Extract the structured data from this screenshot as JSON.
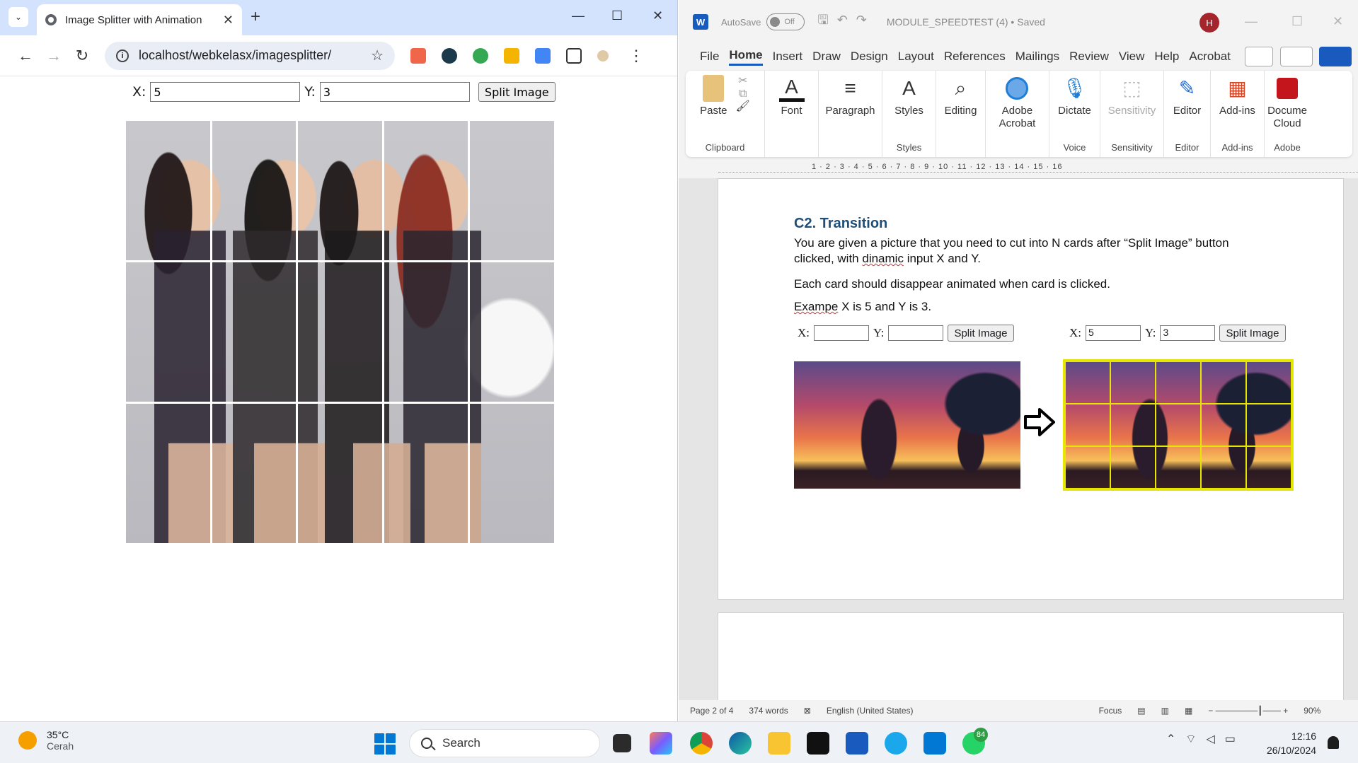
{
  "chrome": {
    "tab_title": "Image Splitter with Animation",
    "url": "localhost/webkelasx/imagesplitter/",
    "page": {
      "x_label": "X:",
      "x_value": "5",
      "y_label": "Y:",
      "y_value": "3",
      "split_button": "Split Image"
    }
  },
  "word": {
    "autosave_label": "AutoSave",
    "autosave_state": "Off",
    "doc_title": "MODULE_SPEEDTEST (4) • Saved",
    "user_initial": "H",
    "menu": [
      "File",
      "Home",
      "Insert",
      "Draw",
      "Design",
      "Layout",
      "References",
      "Mailings",
      "Review",
      "View",
      "Help",
      "Acrobat"
    ],
    "ribbon": {
      "paste": "Paste",
      "clipboard": "Clipboard",
      "font": "Font",
      "paragraph": "Paragraph",
      "styles": "Styles",
      "styles_group": "Styles",
      "editing": "Editing",
      "adobe_acrobat_1": "Adobe",
      "adobe_acrobat_2": "Acrobat",
      "dictate": "Dictate",
      "voice": "Voice",
      "sensitivity": "Sensitivity",
      "sensitivity_group": "Sensitivity",
      "editor": "Editor",
      "editor_group": "Editor",
      "addins": "Add-ins",
      "addins_group": "Add-ins",
      "doc_cloud_1": "Docume",
      "doc_cloud_2": "Cloud",
      "adobe_group": "Adobe"
    },
    "ruler_numbers": "1 · 2 · 3 · 4 · 5 · 6 · 7 · 8 · 9 · 10 · 11 · 12 · 13 · 14 · 15 · 16",
    "document": {
      "heading": "C2. Transition",
      "p1_a": "You are given a picture that you need to cut into N cards after “Split Image” button",
      "p1_b_pre": "clicked, with ",
      "p1_b_err": "dinamic",
      "p1_b_post": " input X and Y.",
      "p2": "Each card should disappear animated when card is clicked.",
      "p3_err": "Exampe",
      "p3_post": " X is 5 and Y is 3.",
      "left_x_label": "X:",
      "left_y_label": "Y:",
      "left_button": "Split Image",
      "right_x_label": "X:",
      "right_x_value": "5",
      "right_y_label": "Y:",
      "right_y_value": "3",
      "right_button": "Split Image"
    },
    "status": {
      "page": "Page 2 of 4",
      "words": "374 words",
      "language": "English (United States)",
      "focus": "Focus",
      "zoom": "90%"
    }
  },
  "taskbar": {
    "temperature": "35°C",
    "condition": "Cerah",
    "search_placeholder": "Search",
    "whatsapp_badge": "84",
    "time": "12:16",
    "date": "26/10/2024"
  }
}
